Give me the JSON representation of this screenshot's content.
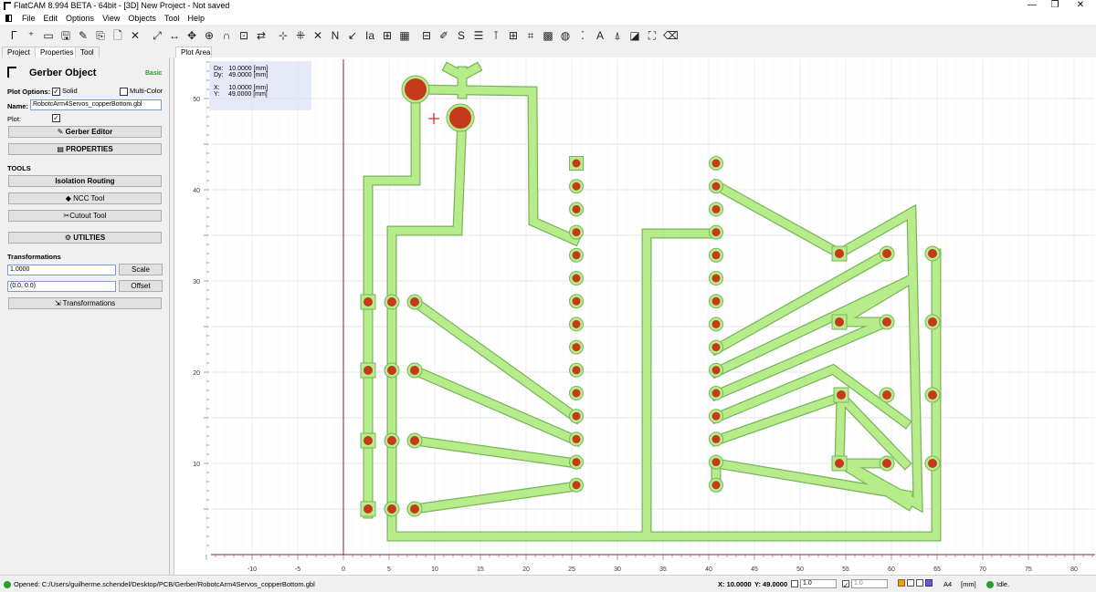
{
  "window": {
    "title": "FlatCAM 8.994 BETA - 64bit - [3D]   New Project - Not saved",
    "minimize": "—",
    "maximize": "❐",
    "close": "✕"
  },
  "menubar": {
    "items": [
      "File",
      "Edit",
      "Options",
      "View",
      "Objects",
      "Tool",
      "Help"
    ]
  },
  "toolbar": {
    "icons": [
      "open-icon",
      "new-geometry-icon",
      "open-folder-icon",
      "save-icon",
      "edit-icon",
      "copy-icon",
      "new-file-icon",
      "delete-icon",
      "zoom-fit-icon",
      "distance-icon",
      "move-icon",
      "origin-icon",
      "mirror-icon",
      "magnet-icon",
      "replot-icon",
      "axis-icon",
      "snap-icon",
      "cross-icon",
      "nc-icon",
      "dblsided-icon",
      "film-icon",
      "panelize-icon",
      "calculator-icon",
      "solder-icon",
      "rules-icon",
      "script-icon",
      "properties-icon",
      "probe-icon",
      "grid-icon",
      "crop-icon",
      "qr-icon",
      "copper-fill-icon",
      "fiducials-icon",
      "text-icon",
      "punch-icon",
      "invert-icon",
      "frame-icon",
      "eraser-icon"
    ],
    "glyphs": [
      "ᒥ",
      "⁺",
      "▭",
      "🖫",
      "✎",
      "⎘",
      "🗋",
      "✕",
      "⤢",
      "↔",
      "✥",
      "⊕",
      "∩",
      "⊡",
      "⇄",
      "⊹",
      "⁜",
      "✕",
      "N",
      "↙",
      "Iа",
      "⊞",
      "▦",
      "⊟",
      "✐",
      "S",
      "☰",
      "⊺",
      "⊞",
      "⌗",
      "▩",
      "◍",
      "⁚",
      "A",
      "⍋",
      "◪",
      "⛶",
      "⌫"
    ]
  },
  "left_tabs": [
    "Project",
    "Properties",
    "Tool"
  ],
  "panel": {
    "object_title": "Gerber Object",
    "mode": "Basic",
    "plot_options_label": "Plot Options:",
    "solid_label": "Solid",
    "solid_checked": true,
    "multicolor_label": "Multi-Color",
    "multicolor_checked": false,
    "name_label": "Name:",
    "name_value": "RobotcArm4Servos_copperBottom.gbl",
    "plot_label": "Plot:",
    "plot_checked": true,
    "gerber_editor_button": "Gerber Editor",
    "properties_button": "PROPERTIES",
    "tools_label": "TOOLS",
    "isolation_button": "Isolation Routing",
    "ncc_button": "NCC Tool",
    "cutout_button": "Cutout Tool",
    "utilities_button": "UTILTIES",
    "transformations_label": "Transformations",
    "scale_value": "1.0000",
    "scale_button": "Scale",
    "offset_value": "(0.0, 0.0)",
    "offset_button": "Offset",
    "transformations_button": "Transformations"
  },
  "plot_tab": "Plot Area",
  "coords": {
    "dx": "Dx:   10.0000 [mm]",
    "dy": "Dy:   49.0000 [mm]",
    "x": "X:     10.0000 [mm]",
    "y": "Y:     49.0000 [mm]"
  },
  "axes": {
    "x_ticks": [
      -10,
      -5,
      0,
      5,
      10,
      15,
      20,
      25,
      30,
      35,
      40,
      45,
      50,
      55,
      60,
      65,
      70,
      75,
      80
    ],
    "y_ticks": [
      10,
      20,
      30,
      40,
      50
    ]
  },
  "colors": {
    "trace": "#b6ec8a",
    "trace_edge": "#7ab55c",
    "pad": "#c63a1c",
    "grid": "#e6e6e6",
    "axis": "#7a2a2a",
    "status_ok": "#2aa02a"
  },
  "statusbar": {
    "message": "Opened: C:/Users/guilherme.schendel/Desktop/PCB/Gerber/RobotcArm4Servos_copperBottom.gbl",
    "x_readout": "X: 10.0000",
    "y_readout": "Y: 49.0000",
    "grid_value_1": "1.0",
    "grid_value_2": "1.0",
    "page_size": "A4",
    "units": "[mm]",
    "state": "Idle."
  }
}
